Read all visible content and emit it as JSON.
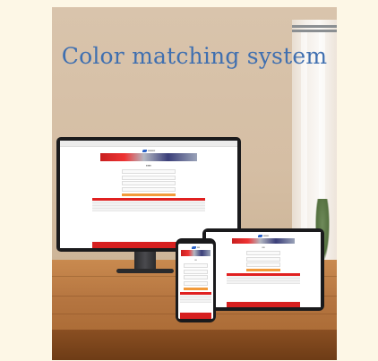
{
  "headline": "Color matching system",
  "colors": {
    "headline": "#3f6fb0",
    "brand_red": "#d61f1f",
    "accent_orange": "#f29a3a",
    "wall": "#d5bea4",
    "table": "#b57540"
  },
  "devices": [
    "monitor",
    "tablet",
    "phone"
  ]
}
